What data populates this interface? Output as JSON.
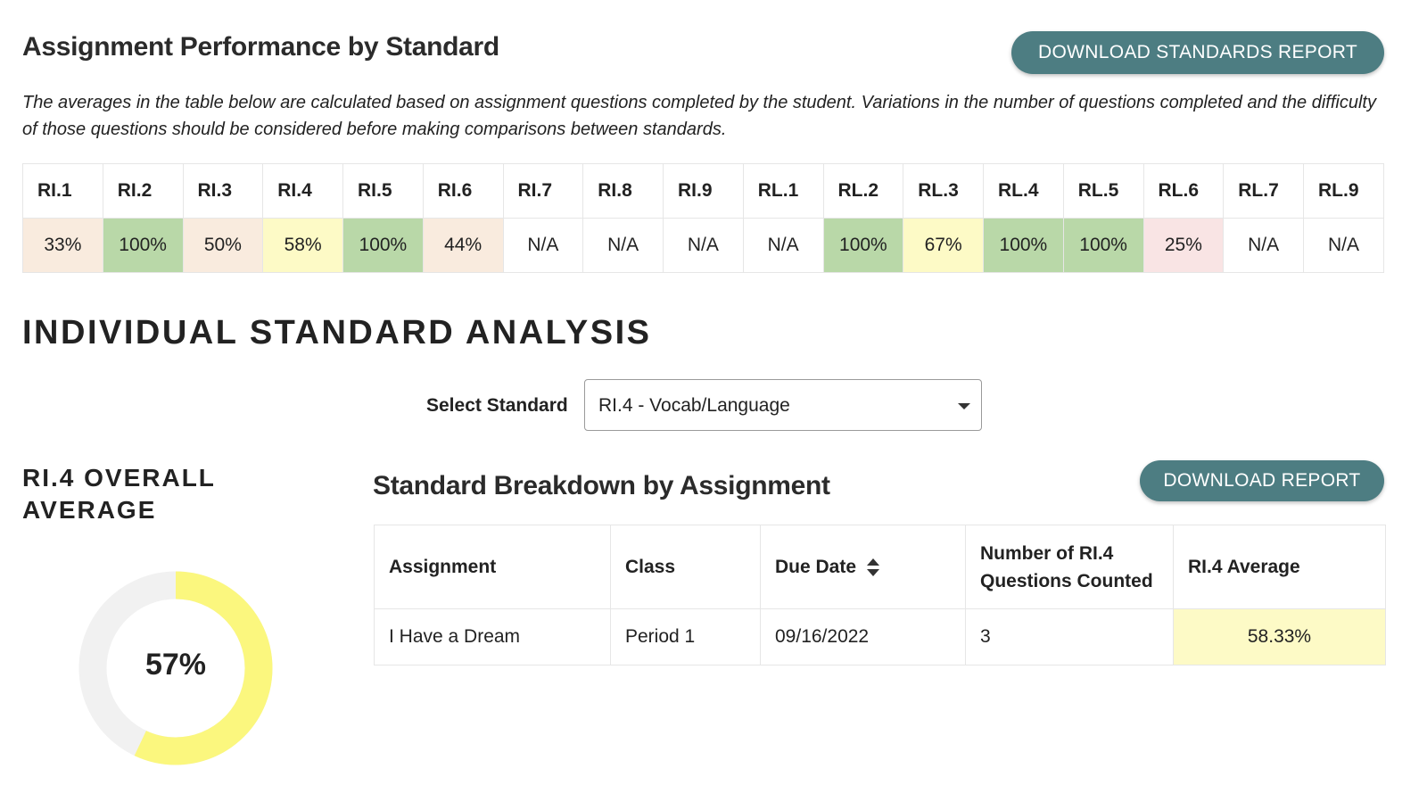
{
  "performance": {
    "title": "Assignment Performance by Standard",
    "download_label": "DOWNLOAD STANDARDS REPORT",
    "note": "The averages in the table below are calculated based on assignment questions completed by the student. Variations in the number of questions completed and the difficulty of those questions should be considered before making comparisons between standards.",
    "standards": [
      {
        "code": "RI.1",
        "value": "33%",
        "color": "#f9ebde"
      },
      {
        "code": "RI.2",
        "value": "100%",
        "color": "#b9d8a8"
      },
      {
        "code": "RI.3",
        "value": "50%",
        "color": "#f9ebde"
      },
      {
        "code": "RI.4",
        "value": "58%",
        "color": "#fdfac6"
      },
      {
        "code": "RI.5",
        "value": "100%",
        "color": "#b9d8a8"
      },
      {
        "code": "RI.6",
        "value": "44%",
        "color": "#f9ebde"
      },
      {
        "code": "RI.7",
        "value": "N/A",
        "color": "#ffffff"
      },
      {
        "code": "RI.8",
        "value": "N/A",
        "color": "#ffffff"
      },
      {
        "code": "RI.9",
        "value": "N/A",
        "color": "#ffffff"
      },
      {
        "code": "RL.1",
        "value": "N/A",
        "color": "#ffffff"
      },
      {
        "code": "RL.2",
        "value": "100%",
        "color": "#b9d8a8"
      },
      {
        "code": "RL.3",
        "value": "67%",
        "color": "#fdfac6"
      },
      {
        "code": "RL.4",
        "value": "100%",
        "color": "#b9d8a8"
      },
      {
        "code": "RL.5",
        "value": "100%",
        "color": "#b9d8a8"
      },
      {
        "code": "RL.6",
        "value": "25%",
        "color": "#f9e4e4"
      },
      {
        "code": "RL.7",
        "value": "N/A",
        "color": "#ffffff"
      },
      {
        "code": "RL.9",
        "value": "N/A",
        "color": "#ffffff"
      }
    ]
  },
  "analysis": {
    "title": "INDIVIDUAL STANDARD ANALYSIS",
    "select_label": "Select Standard",
    "select_value": "RI.4 - Vocab/Language",
    "overall_title": "RI.4 OVERALL AVERAGE",
    "overall_value": "57%",
    "overall_fraction": 0.57,
    "donut_fill_color": "#fbf77e",
    "donut_track_color": "#f1f1f1",
    "breakdown_title": "Standard Breakdown by Assignment",
    "download_label": "DOWNLOAD REPORT",
    "columns": {
      "assignment": "Assignment",
      "class": "Class",
      "due_date": "Due Date",
      "count": "Number of RI.4 Questions Counted",
      "average": "RI.4 Average"
    },
    "rows": [
      {
        "assignment": "I Have a Dream",
        "class": "Period 1",
        "due_date": "09/16/2022",
        "count": "3",
        "average": "58.33%",
        "average_color": "#fdfac6"
      }
    ]
  },
  "colors": {
    "accent": "#4d7d82"
  }
}
